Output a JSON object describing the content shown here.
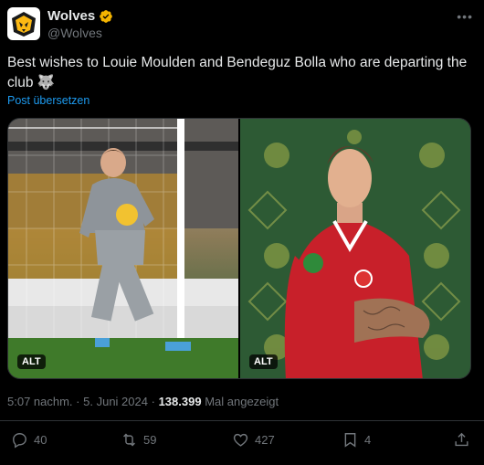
{
  "author": {
    "display_name": "Wolves",
    "handle": "@Wolves",
    "verified": true
  },
  "tweet": {
    "text": "Best wishes to Louie Moulden and Bendeguz Bolla who are departing the club 🐺",
    "translate_label": "Post übersetzen"
  },
  "media": {
    "images": [
      {
        "alt_label": "ALT"
      },
      {
        "alt_label": "ALT"
      }
    ]
  },
  "meta": {
    "time": "5:07 nachm.",
    "separator": "·",
    "date": "5. Juni 2024",
    "views": "138.399",
    "views_label": "Mal angezeigt"
  },
  "actions": {
    "replies": "40",
    "reposts": "59",
    "likes": "427",
    "bookmarks": "4"
  },
  "colors": {
    "background": "#000000",
    "text": "#e7e9ea",
    "muted": "#71767b",
    "link": "#1d9bf0",
    "verified_badge": "#f4b400"
  },
  "icons": [
    "wolves-logo-icon",
    "verified-badge-icon",
    "more-icon",
    "reply-icon",
    "repost-icon",
    "like-icon",
    "bookmark-icon",
    "share-icon"
  ]
}
